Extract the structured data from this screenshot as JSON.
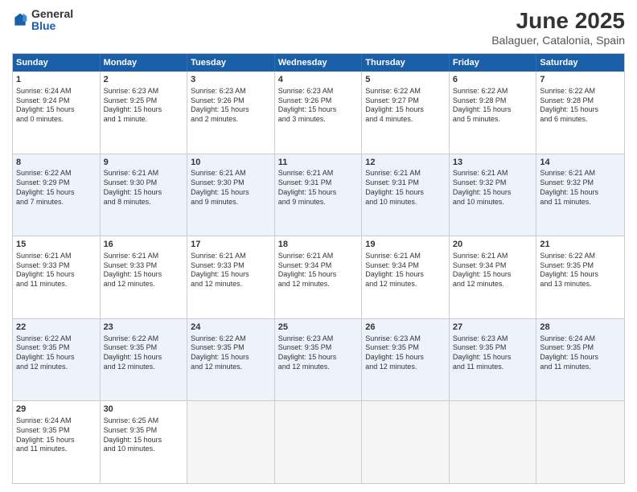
{
  "logo": {
    "general": "General",
    "blue": "Blue"
  },
  "title": "June 2025",
  "subtitle": "Balaguer, Catalonia, Spain",
  "days": [
    "Sunday",
    "Monday",
    "Tuesday",
    "Wednesday",
    "Thursday",
    "Friday",
    "Saturday"
  ],
  "rows": [
    [
      {
        "day": "1",
        "lines": [
          "Sunrise: 6:24 AM",
          "Sunset: 9:24 PM",
          "Daylight: 15 hours",
          "and 0 minutes."
        ]
      },
      {
        "day": "2",
        "lines": [
          "Sunrise: 6:23 AM",
          "Sunset: 9:25 PM",
          "Daylight: 15 hours",
          "and 1 minute."
        ]
      },
      {
        "day": "3",
        "lines": [
          "Sunrise: 6:23 AM",
          "Sunset: 9:26 PM",
          "Daylight: 15 hours",
          "and 2 minutes."
        ]
      },
      {
        "day": "4",
        "lines": [
          "Sunrise: 6:23 AM",
          "Sunset: 9:26 PM",
          "Daylight: 15 hours",
          "and 3 minutes."
        ]
      },
      {
        "day": "5",
        "lines": [
          "Sunrise: 6:22 AM",
          "Sunset: 9:27 PM",
          "Daylight: 15 hours",
          "and 4 minutes."
        ]
      },
      {
        "day": "6",
        "lines": [
          "Sunrise: 6:22 AM",
          "Sunset: 9:28 PM",
          "Daylight: 15 hours",
          "and 5 minutes."
        ]
      },
      {
        "day": "7",
        "lines": [
          "Sunrise: 6:22 AM",
          "Sunset: 9:28 PM",
          "Daylight: 15 hours",
          "and 6 minutes."
        ]
      }
    ],
    [
      {
        "day": "8",
        "lines": [
          "Sunrise: 6:22 AM",
          "Sunset: 9:29 PM",
          "Daylight: 15 hours",
          "and 7 minutes."
        ]
      },
      {
        "day": "9",
        "lines": [
          "Sunrise: 6:21 AM",
          "Sunset: 9:30 PM",
          "Daylight: 15 hours",
          "and 8 minutes."
        ]
      },
      {
        "day": "10",
        "lines": [
          "Sunrise: 6:21 AM",
          "Sunset: 9:30 PM",
          "Daylight: 15 hours",
          "and 9 minutes."
        ]
      },
      {
        "day": "11",
        "lines": [
          "Sunrise: 6:21 AM",
          "Sunset: 9:31 PM",
          "Daylight: 15 hours",
          "and 9 minutes."
        ]
      },
      {
        "day": "12",
        "lines": [
          "Sunrise: 6:21 AM",
          "Sunset: 9:31 PM",
          "Daylight: 15 hours",
          "and 10 minutes."
        ]
      },
      {
        "day": "13",
        "lines": [
          "Sunrise: 6:21 AM",
          "Sunset: 9:32 PM",
          "Daylight: 15 hours",
          "and 10 minutes."
        ]
      },
      {
        "day": "14",
        "lines": [
          "Sunrise: 6:21 AM",
          "Sunset: 9:32 PM",
          "Daylight: 15 hours",
          "and 11 minutes."
        ]
      }
    ],
    [
      {
        "day": "15",
        "lines": [
          "Sunrise: 6:21 AM",
          "Sunset: 9:33 PM",
          "Daylight: 15 hours",
          "and 11 minutes."
        ]
      },
      {
        "day": "16",
        "lines": [
          "Sunrise: 6:21 AM",
          "Sunset: 9:33 PM",
          "Daylight: 15 hours",
          "and 12 minutes."
        ]
      },
      {
        "day": "17",
        "lines": [
          "Sunrise: 6:21 AM",
          "Sunset: 9:33 PM",
          "Daylight: 15 hours",
          "and 12 minutes."
        ]
      },
      {
        "day": "18",
        "lines": [
          "Sunrise: 6:21 AM",
          "Sunset: 9:34 PM",
          "Daylight: 15 hours",
          "and 12 minutes."
        ]
      },
      {
        "day": "19",
        "lines": [
          "Sunrise: 6:21 AM",
          "Sunset: 9:34 PM",
          "Daylight: 15 hours",
          "and 12 minutes."
        ]
      },
      {
        "day": "20",
        "lines": [
          "Sunrise: 6:21 AM",
          "Sunset: 9:34 PM",
          "Daylight: 15 hours",
          "and 12 minutes."
        ]
      },
      {
        "day": "21",
        "lines": [
          "Sunrise: 6:22 AM",
          "Sunset: 9:35 PM",
          "Daylight: 15 hours",
          "and 13 minutes."
        ]
      }
    ],
    [
      {
        "day": "22",
        "lines": [
          "Sunrise: 6:22 AM",
          "Sunset: 9:35 PM",
          "Daylight: 15 hours",
          "and 12 minutes."
        ]
      },
      {
        "day": "23",
        "lines": [
          "Sunrise: 6:22 AM",
          "Sunset: 9:35 PM",
          "Daylight: 15 hours",
          "and 12 minutes."
        ]
      },
      {
        "day": "24",
        "lines": [
          "Sunrise: 6:22 AM",
          "Sunset: 9:35 PM",
          "Daylight: 15 hours",
          "and 12 minutes."
        ]
      },
      {
        "day": "25",
        "lines": [
          "Sunrise: 6:23 AM",
          "Sunset: 9:35 PM",
          "Daylight: 15 hours",
          "and 12 minutes."
        ]
      },
      {
        "day": "26",
        "lines": [
          "Sunrise: 6:23 AM",
          "Sunset: 9:35 PM",
          "Daylight: 15 hours",
          "and 12 minutes."
        ]
      },
      {
        "day": "27",
        "lines": [
          "Sunrise: 6:23 AM",
          "Sunset: 9:35 PM",
          "Daylight: 15 hours",
          "and 11 minutes."
        ]
      },
      {
        "day": "28",
        "lines": [
          "Sunrise: 6:24 AM",
          "Sunset: 9:35 PM",
          "Daylight: 15 hours",
          "and 11 minutes."
        ]
      }
    ],
    [
      {
        "day": "29",
        "lines": [
          "Sunrise: 6:24 AM",
          "Sunset: 9:35 PM",
          "Daylight: 15 hours",
          "and 11 minutes."
        ]
      },
      {
        "day": "30",
        "lines": [
          "Sunrise: 6:25 AM",
          "Sunset: 9:35 PM",
          "Daylight: 15 hours",
          "and 10 minutes."
        ]
      },
      {
        "day": "",
        "lines": []
      },
      {
        "day": "",
        "lines": []
      },
      {
        "day": "",
        "lines": []
      },
      {
        "day": "",
        "lines": []
      },
      {
        "day": "",
        "lines": []
      }
    ]
  ]
}
